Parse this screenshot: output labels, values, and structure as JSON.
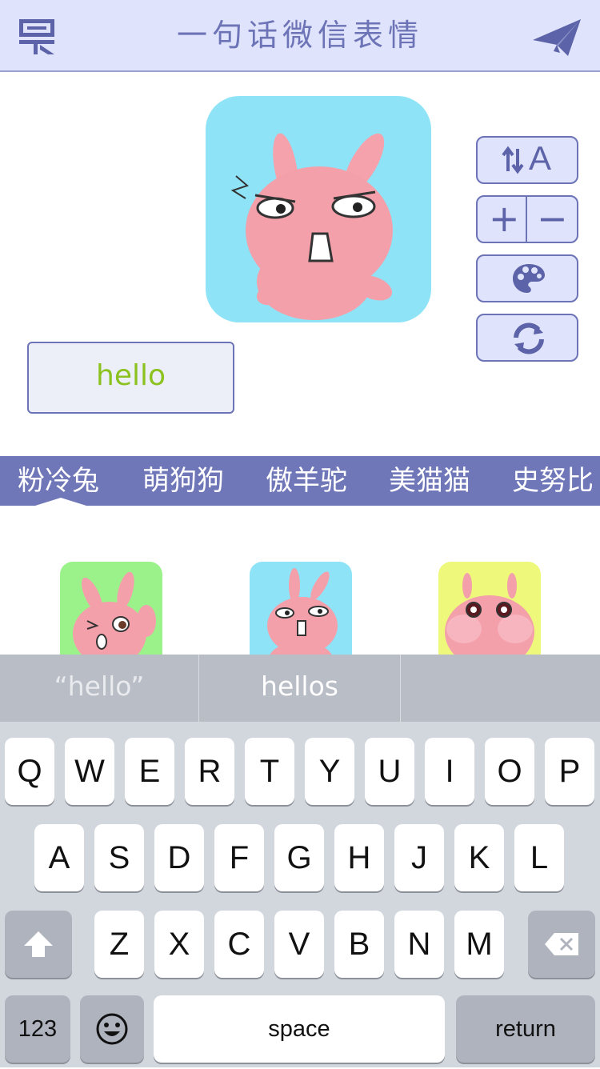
{
  "header": {
    "title": "一句话微信表情",
    "menu_icon": "menu-list-icon",
    "send_icon": "paper-plane-icon"
  },
  "tools": {
    "font_label": "A",
    "size_plus": "+",
    "size_minus": "−",
    "color_icon": "palette-icon",
    "refresh_icon": "refresh-icon"
  },
  "text_input": {
    "value": "hello"
  },
  "tabs": [
    {
      "label": "粉冷兔"
    },
    {
      "label": "萌狗狗"
    },
    {
      "label": "傲羊驼"
    },
    {
      "label": "美猫猫"
    },
    {
      "label": "史努比"
    }
  ],
  "suggestions": [
    {
      "text": "“hello”"
    },
    {
      "text": "hellos"
    },
    {
      "text": ""
    }
  ],
  "keyboard": {
    "row1": [
      "Q",
      "W",
      "E",
      "R",
      "T",
      "Y",
      "U",
      "I",
      "O",
      "P"
    ],
    "row2": [
      "A",
      "S",
      "D",
      "F",
      "G",
      "H",
      "J",
      "K",
      "L"
    ],
    "row3": [
      "Z",
      "X",
      "C",
      "V",
      "B",
      "N",
      "M"
    ],
    "numbers_label": "123",
    "space_label": "space",
    "return_label": "return",
    "shift_icon": "shift-arrow-icon",
    "delete_icon": "backspace-icon",
    "emoji_icon": "emoji-smile-icon"
  },
  "colors": {
    "accent": "#6f77b8",
    "header_bg": "#dfe3fb",
    "text_green": "#8cc21f",
    "preview_bg": "#8fe3f7",
    "thumb_green": "#9cf28a",
    "thumb_blue": "#8fe3f7",
    "thumb_yellow": "#eef97c"
  }
}
